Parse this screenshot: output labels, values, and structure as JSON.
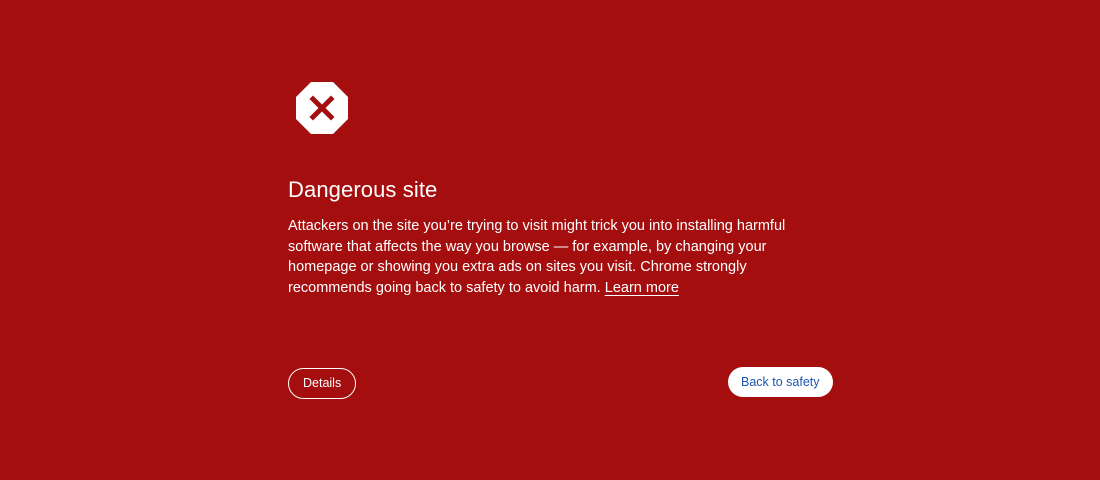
{
  "interstitial": {
    "icon": "dangerous-site-icon",
    "title": "Dangerous site",
    "body": "Attackers on the site you’re trying to visit might trick you into installing harmful software that affects the way you browse — for example, by changing your homepage or showing you extra ads on sites you visit. Chrome strongly recommends going back to safety to avoid harm.",
    "learn_more_label": "Learn more"
  },
  "buttons": {
    "details_label": "Details",
    "back_to_safety_label": "Back to safety"
  },
  "colors": {
    "background": "#a50e0e",
    "icon_fill": "#ffffff",
    "icon_mark": "#a50e0e",
    "primary_button_text": "#1a56b0"
  }
}
